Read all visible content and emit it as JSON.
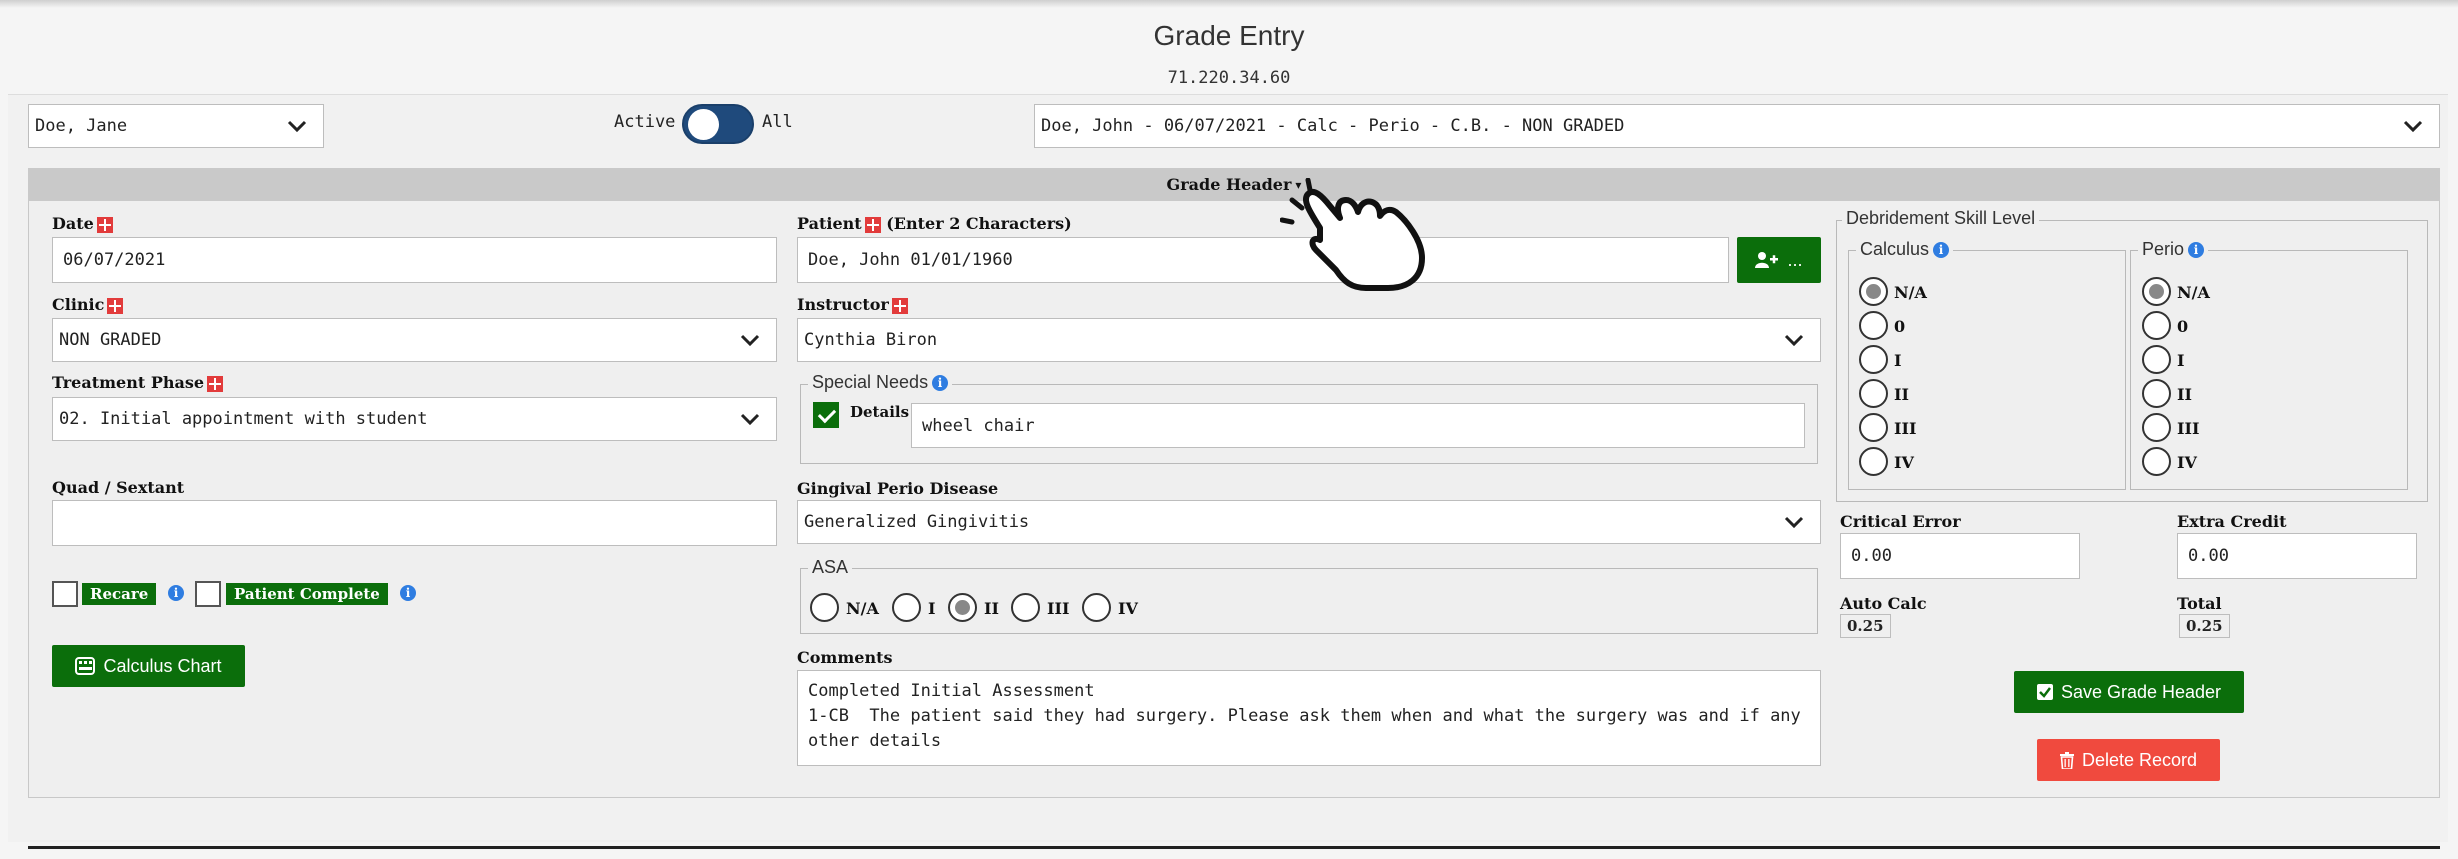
{
  "page": {
    "title": "Grade Entry",
    "ip": "71.220.34.60"
  },
  "top": {
    "student_select": "Doe, Jane",
    "toggle_active": "Active",
    "toggle_all": "All",
    "record_select": "Doe, John - 06/07/2021 - Calc - Perio - C.B. - NON GRADED"
  },
  "grade_header": {
    "title": "Grade Header",
    "date_label": "Date",
    "date_value": "06/07/2021",
    "clinic_label": "Clinic",
    "clinic_value": "NON GRADED",
    "phase_label": "Treatment Phase",
    "phase_value": "02. Initial appointment with student",
    "quad_label": "Quad / Sextant",
    "quad_value": "",
    "recare_label": "Recare",
    "patient_complete_label": "Patient Complete",
    "calculus_chart_label": "Calculus Chart",
    "patient_label": "Patient",
    "patient_hint": "(Enter 2 Characters)",
    "patient_value": "Doe, John 01/01/1960",
    "patient_button_label": "...",
    "instructor_label": "Instructor",
    "instructor_value": "Cynthia Biron",
    "special_needs_legend": "Special Needs",
    "details_label": "Details",
    "details_value": "wheel chair",
    "gingival_label": "Gingival Perio Disease",
    "gingival_value": "Generalized Gingivitis",
    "asa_legend": "ASA",
    "asa_options": [
      "N/A",
      "I",
      "II",
      "III",
      "IV"
    ],
    "asa_selected": "II",
    "comments_label": "Comments",
    "comments_value": "Completed Initial Assessment\n1-CB  The patient said they had surgery. Please ask them when and what the surgery was and if any other details",
    "debridement_legend": "Debridement Skill Level",
    "calculus_legend": "Calculus",
    "perio_legend": "Perio",
    "skill_options": [
      "N/A",
      "0",
      "I",
      "II",
      "III",
      "IV"
    ],
    "calculus_selected": "N/A",
    "perio_selected": "N/A",
    "critical_error_label": "Critical Error",
    "critical_error_value": "0.00",
    "extra_credit_label": "Extra Credit",
    "extra_credit_value": "0.00",
    "auto_calc_label": "Auto Calc",
    "auto_calc_value": "0.25",
    "total_label": "Total",
    "total_value": "0.25",
    "save_label": "Save Grade Header",
    "delete_label": "Delete Record"
  },
  "colors": {
    "green": "#0b6e0b",
    "red": "#f04a3e",
    "toggle": "#1f4a7c",
    "info": "#2f7de1"
  }
}
